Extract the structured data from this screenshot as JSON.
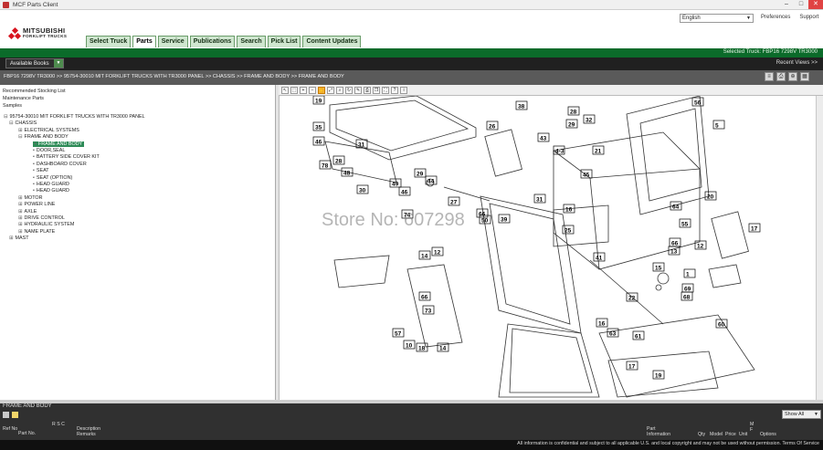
{
  "window": {
    "title": "MCF Parts Client",
    "btn_min": "–",
    "btn_max": "□",
    "btn_close": "✕"
  },
  "header": {
    "brand_line1": "MITSUBISHI",
    "brand_line2": "FORKLIFT TRUCKS",
    "language": "English",
    "links": [
      "Preferences",
      "Support"
    ],
    "tabs": [
      {
        "label": "Select Truck",
        "active": false
      },
      {
        "label": "Parts",
        "active": true
      },
      {
        "label": "Service",
        "active": false
      },
      {
        "label": "Publications",
        "active": false
      },
      {
        "label": "Search",
        "active": false
      },
      {
        "label": "Pick List",
        "active": false
      },
      {
        "label": "Content Updates",
        "active": false
      }
    ],
    "selected_truck": "Selected Truck: FBP16 7298V TR3000"
  },
  "bookbar": {
    "available_books": "Available Books",
    "recent_views": "Recent Views >>"
  },
  "breadcrumb": "FBP16 7298V TR3000 >> 95754-30010 MIT FORKLIFT TRUCKS WITH TR3000 PANEL >> CHASSIS >> FRAME AND BODY >> FRAME AND BODY",
  "tree": {
    "top_links": [
      "Recommended Stocking List",
      "Maintenance Parts",
      "Samples"
    ],
    "items": [
      {
        "label": "95754-30010 MIT FORKLIFT TRUCKS WITH TR3000 PANEL",
        "prefix": "⊟",
        "level": 0
      },
      {
        "label": "CHASSIS",
        "prefix": "⊟",
        "level": 1
      },
      {
        "label": "ELECTRICAL SYSTEMS",
        "prefix": "⊞",
        "level": 2
      },
      {
        "label": "FRAME AND BODY",
        "prefix": "⊟",
        "level": 2
      },
      {
        "label": "FRAME AND BODY",
        "prefix": "▪",
        "level": 3,
        "selected": true
      },
      {
        "label": "DOOR,SEAL",
        "prefix": "▪",
        "level": 3
      },
      {
        "label": "BATTERY SIDE COVER KIT",
        "prefix": "▪",
        "level": 3
      },
      {
        "label": "DASHBOARD COVER",
        "prefix": "▪",
        "level": 3
      },
      {
        "label": "SEAT",
        "prefix": "▪",
        "level": 3
      },
      {
        "label": "SEAT (OPTION)",
        "prefix": "▪",
        "level": 3
      },
      {
        "label": "HEAD GUARD",
        "prefix": "▪",
        "level": 3
      },
      {
        "label": "HEAD GUARD",
        "prefix": "▪",
        "level": 3
      },
      {
        "label": "MOTOR",
        "prefix": "⊞",
        "level": 2
      },
      {
        "label": "POWER LINE",
        "prefix": "⊞",
        "level": 2
      },
      {
        "label": "AXLE",
        "prefix": "⊞",
        "level": 2
      },
      {
        "label": "DRIVE CONTROL",
        "prefix": "⊞",
        "level": 2
      },
      {
        "label": "HYDRAULIC SYSTEM",
        "prefix": "⊞",
        "level": 2
      },
      {
        "label": "NAME PLATE",
        "prefix": "⊞",
        "level": 2
      },
      {
        "label": "MAST",
        "prefix": "⊞",
        "level": 1
      }
    ]
  },
  "diagram": {
    "watermark": "Store No: 607298",
    "callout_labels": [
      "19",
      "56",
      "35",
      "38",
      "28",
      "32",
      "26",
      "29",
      "5",
      "46",
      "43",
      "4-3",
      "21",
      "31",
      "78",
      "28",
      "48",
      "45",
      "30",
      "29",
      "44",
      "49",
      "46",
      "31",
      "27",
      "20",
      "74",
      "66",
      "16",
      "64",
      "55",
      "39",
      "17",
      "25",
      "66",
      "13",
      "12",
      "14",
      "41",
      "15",
      "1",
      "66",
      "69",
      "68",
      "73",
      "22",
      "57",
      "10",
      "18",
      "14",
      "63",
      "61",
      "60",
      "17",
      "19",
      "50",
      "16",
      "12"
    ]
  },
  "bottom": {
    "title": "FRAME AND BODY",
    "show_all": "Show All",
    "columns": [
      {
        "label": "Ref No",
        "id": "ref"
      },
      {
        "label": "Part No.",
        "id": "part"
      },
      {
        "label": "R S C",
        "id": "rsc"
      },
      {
        "label": "Description",
        "id": "desc"
      },
      {
        "label": "Remarks",
        "id": "remarks"
      },
      {
        "label": "Part Information",
        "id": "info"
      },
      {
        "label": "Qty",
        "id": "qty"
      },
      {
        "label": "Model",
        "id": "model"
      },
      {
        "label": "Price",
        "id": "price"
      },
      {
        "label": "Unit",
        "id": "unit"
      },
      {
        "label": "M F",
        "id": "mf"
      },
      {
        "label": "Options",
        "id": "options"
      }
    ]
  },
  "footer": "All information is confidential and subject to all applicable U.S. and local copyright and may not be used without permission. Terms Of Service"
}
